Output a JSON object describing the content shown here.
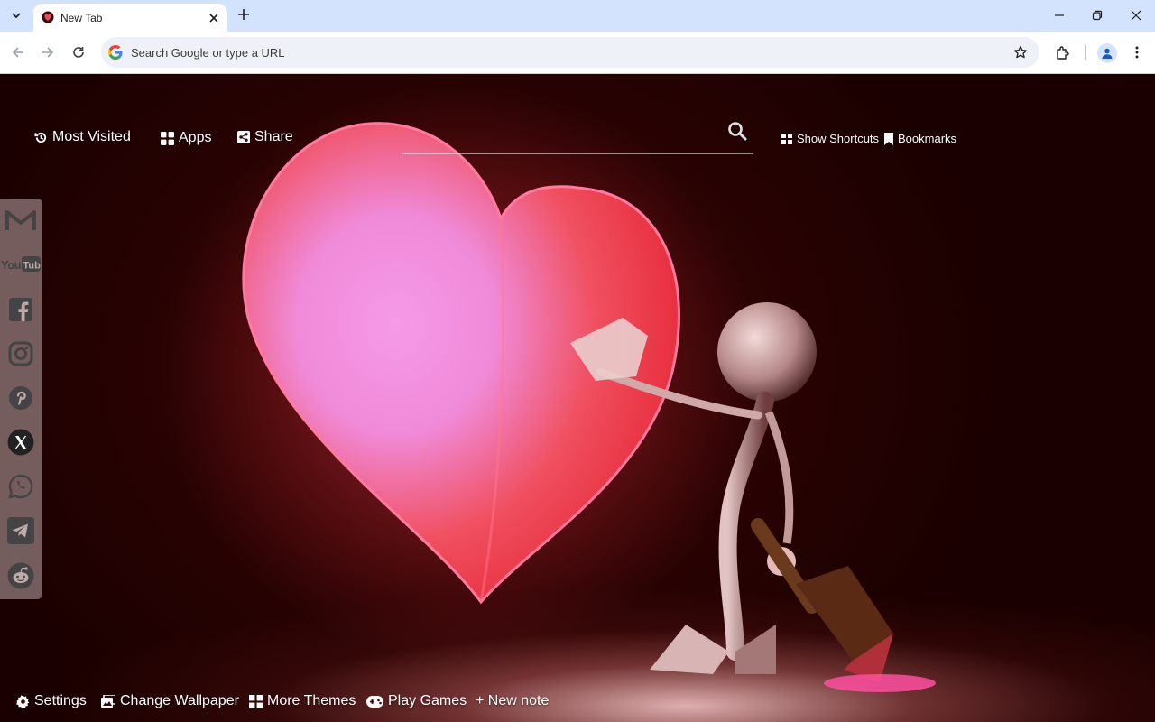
{
  "browser": {
    "tab_title": "New Tab",
    "omnibox_placeholder": "Search Google or type a URL"
  },
  "topnav": {
    "most_visited": "Most Visited",
    "apps": "Apps",
    "share": "Share",
    "show_shortcuts": "Show Shortcuts",
    "bookmarks": "Bookmarks"
  },
  "sidebar": {
    "items": [
      {
        "name": "gmail"
      },
      {
        "name": "youtube",
        "label": "YouTube"
      },
      {
        "name": "facebook"
      },
      {
        "name": "instagram"
      },
      {
        "name": "pinterest"
      },
      {
        "name": "x"
      },
      {
        "name": "whatsapp"
      },
      {
        "name": "telegram"
      },
      {
        "name": "reddit"
      }
    ]
  },
  "bottom": {
    "settings": "Settings",
    "change_wallpaper": "Change Wallpaper",
    "more_themes": "More Themes",
    "play_games": "Play Games",
    "new_note": "+ New note"
  },
  "colors": {
    "tabbar_bg": "#d3e3fd",
    "heart": "#f0434f",
    "background": "#2a0303"
  }
}
